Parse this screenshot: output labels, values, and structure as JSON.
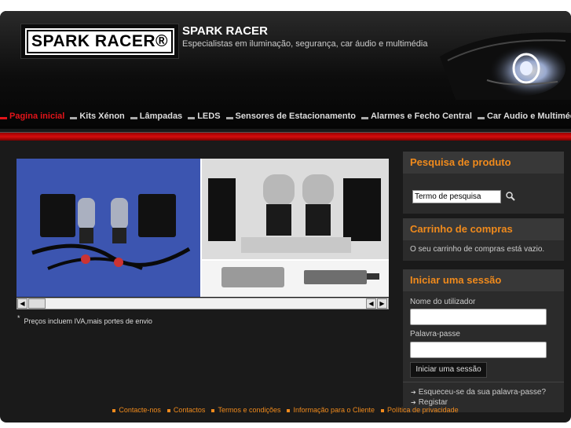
{
  "header": {
    "logo_text": "SPARK RACER®",
    "site_title": "SPARK RACER",
    "tagline": "Especialistas em iluminação, segurança, car áudio e multimédia"
  },
  "nav": {
    "items": [
      {
        "label": "Pagina inicial",
        "active": true
      },
      {
        "label": "Kits Xénon"
      },
      {
        "label": "Lâmpadas"
      },
      {
        "label": "LEDS"
      },
      {
        "label": "Sensores de Estacionamento"
      },
      {
        "label": "Alarmes e Fecho Central"
      },
      {
        "label": "Car Audio e Multimédia"
      }
    ]
  },
  "main": {
    "price_note_mark": "*",
    "price_note": "Preços incluem IVA,mais portes de envio"
  },
  "sidebar": {
    "search": {
      "title": "Pesquisa de produto",
      "input_value": "Termo de pesquisa"
    },
    "cart": {
      "title": "Carrinho de compras",
      "empty_text": "O seu carrinho de compras está vazio."
    },
    "login": {
      "title": "Iniciar uma sessão",
      "username_label": "Nome do utilizador",
      "password_label": "Palavra-passe",
      "button_label": "Iniciar uma sessão",
      "forgot_link": "Esqueceu-se da sua palavra-passe?",
      "register_link": "Registar"
    }
  },
  "footer": {
    "items": [
      "Contacte-nos",
      "Contactos",
      "Termos e condições",
      "Informação para o Cliente",
      "Política de privacidade"
    ]
  },
  "colors": {
    "accent_red": "#e3141a",
    "accent_orange": "#f08a1c",
    "background": "#1a1a1a"
  }
}
